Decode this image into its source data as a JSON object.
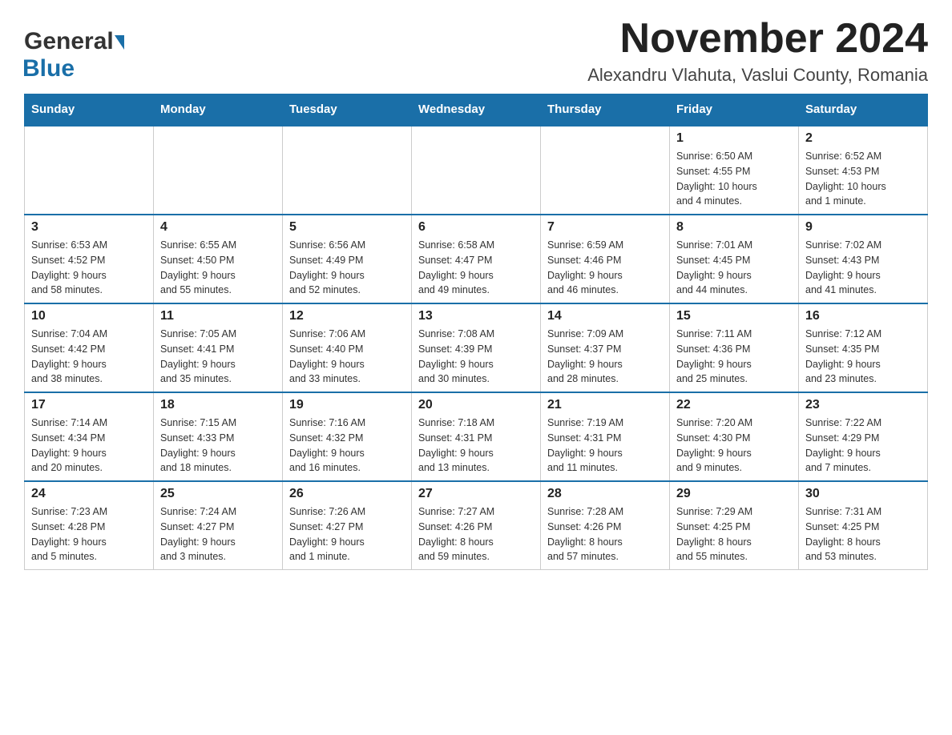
{
  "header": {
    "logo_general": "General",
    "logo_blue": "Blue",
    "month_title": "November 2024",
    "location": "Alexandru Vlahuta, Vaslui County, Romania"
  },
  "weekdays": [
    "Sunday",
    "Monday",
    "Tuesday",
    "Wednesday",
    "Thursday",
    "Friday",
    "Saturday"
  ],
  "weeks": [
    [
      {
        "day": "",
        "info": ""
      },
      {
        "day": "",
        "info": ""
      },
      {
        "day": "",
        "info": ""
      },
      {
        "day": "",
        "info": ""
      },
      {
        "day": "",
        "info": ""
      },
      {
        "day": "1",
        "info": "Sunrise: 6:50 AM\nSunset: 4:55 PM\nDaylight: 10 hours\nand 4 minutes."
      },
      {
        "day": "2",
        "info": "Sunrise: 6:52 AM\nSunset: 4:53 PM\nDaylight: 10 hours\nand 1 minute."
      }
    ],
    [
      {
        "day": "3",
        "info": "Sunrise: 6:53 AM\nSunset: 4:52 PM\nDaylight: 9 hours\nand 58 minutes."
      },
      {
        "day": "4",
        "info": "Sunrise: 6:55 AM\nSunset: 4:50 PM\nDaylight: 9 hours\nand 55 minutes."
      },
      {
        "day": "5",
        "info": "Sunrise: 6:56 AM\nSunset: 4:49 PM\nDaylight: 9 hours\nand 52 minutes."
      },
      {
        "day": "6",
        "info": "Sunrise: 6:58 AM\nSunset: 4:47 PM\nDaylight: 9 hours\nand 49 minutes."
      },
      {
        "day": "7",
        "info": "Sunrise: 6:59 AM\nSunset: 4:46 PM\nDaylight: 9 hours\nand 46 minutes."
      },
      {
        "day": "8",
        "info": "Sunrise: 7:01 AM\nSunset: 4:45 PM\nDaylight: 9 hours\nand 44 minutes."
      },
      {
        "day": "9",
        "info": "Sunrise: 7:02 AM\nSunset: 4:43 PM\nDaylight: 9 hours\nand 41 minutes."
      }
    ],
    [
      {
        "day": "10",
        "info": "Sunrise: 7:04 AM\nSunset: 4:42 PM\nDaylight: 9 hours\nand 38 minutes."
      },
      {
        "day": "11",
        "info": "Sunrise: 7:05 AM\nSunset: 4:41 PM\nDaylight: 9 hours\nand 35 minutes."
      },
      {
        "day": "12",
        "info": "Sunrise: 7:06 AM\nSunset: 4:40 PM\nDaylight: 9 hours\nand 33 minutes."
      },
      {
        "day": "13",
        "info": "Sunrise: 7:08 AM\nSunset: 4:39 PM\nDaylight: 9 hours\nand 30 minutes."
      },
      {
        "day": "14",
        "info": "Sunrise: 7:09 AM\nSunset: 4:37 PM\nDaylight: 9 hours\nand 28 minutes."
      },
      {
        "day": "15",
        "info": "Sunrise: 7:11 AM\nSunset: 4:36 PM\nDaylight: 9 hours\nand 25 minutes."
      },
      {
        "day": "16",
        "info": "Sunrise: 7:12 AM\nSunset: 4:35 PM\nDaylight: 9 hours\nand 23 minutes."
      }
    ],
    [
      {
        "day": "17",
        "info": "Sunrise: 7:14 AM\nSunset: 4:34 PM\nDaylight: 9 hours\nand 20 minutes."
      },
      {
        "day": "18",
        "info": "Sunrise: 7:15 AM\nSunset: 4:33 PM\nDaylight: 9 hours\nand 18 minutes."
      },
      {
        "day": "19",
        "info": "Sunrise: 7:16 AM\nSunset: 4:32 PM\nDaylight: 9 hours\nand 16 minutes."
      },
      {
        "day": "20",
        "info": "Sunrise: 7:18 AM\nSunset: 4:31 PM\nDaylight: 9 hours\nand 13 minutes."
      },
      {
        "day": "21",
        "info": "Sunrise: 7:19 AM\nSunset: 4:31 PM\nDaylight: 9 hours\nand 11 minutes."
      },
      {
        "day": "22",
        "info": "Sunrise: 7:20 AM\nSunset: 4:30 PM\nDaylight: 9 hours\nand 9 minutes."
      },
      {
        "day": "23",
        "info": "Sunrise: 7:22 AM\nSunset: 4:29 PM\nDaylight: 9 hours\nand 7 minutes."
      }
    ],
    [
      {
        "day": "24",
        "info": "Sunrise: 7:23 AM\nSunset: 4:28 PM\nDaylight: 9 hours\nand 5 minutes."
      },
      {
        "day": "25",
        "info": "Sunrise: 7:24 AM\nSunset: 4:27 PM\nDaylight: 9 hours\nand 3 minutes."
      },
      {
        "day": "26",
        "info": "Sunrise: 7:26 AM\nSunset: 4:27 PM\nDaylight: 9 hours\nand 1 minute."
      },
      {
        "day": "27",
        "info": "Sunrise: 7:27 AM\nSunset: 4:26 PM\nDaylight: 8 hours\nand 59 minutes."
      },
      {
        "day": "28",
        "info": "Sunrise: 7:28 AM\nSunset: 4:26 PM\nDaylight: 8 hours\nand 57 minutes."
      },
      {
        "day": "29",
        "info": "Sunrise: 7:29 AM\nSunset: 4:25 PM\nDaylight: 8 hours\nand 55 minutes."
      },
      {
        "day": "30",
        "info": "Sunrise: 7:31 AM\nSunset: 4:25 PM\nDaylight: 8 hours\nand 53 minutes."
      }
    ]
  ]
}
